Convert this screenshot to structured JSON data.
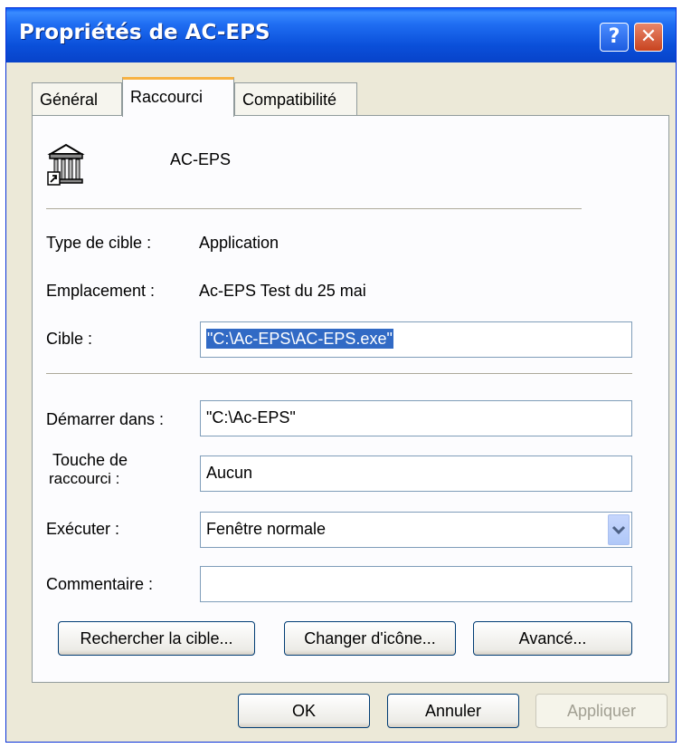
{
  "window": {
    "title": "Propriétés de AC-EPS",
    "help": "?",
    "close": "✕"
  },
  "tabs": [
    {
      "label": "Général",
      "active": false
    },
    {
      "label": "Raccourci",
      "active": true
    },
    {
      "label": "Compatibilité",
      "active": false
    }
  ],
  "shortcut": {
    "icon": "shortcut-app-icon",
    "name": "AC-EPS",
    "target_type_label": "Type de cible :",
    "target_type_value": "Application",
    "location_label": "Emplacement :",
    "location_value": "Ac-EPS Test du 25 mai",
    "target_label": "Cible :",
    "target_value": "\"C:\\Ac-EPS\\AC-EPS.exe\"",
    "start_in_label": "Démarrer dans :",
    "start_in_value": "\"C:\\Ac-EPS\"",
    "hotkey_label_1": "Touche de",
    "hotkey_label_2": "raccourci :",
    "hotkey_value": "Aucun",
    "run_label": "Exécuter :",
    "run_value": "Fenêtre normale",
    "comment_label": "Commentaire :",
    "comment_value": "",
    "find_target_button": "Rechercher la cible...",
    "change_icon_button": "Changer d'icône...",
    "advanced_button": "Avancé..."
  },
  "footer": {
    "ok": "OK",
    "cancel": "Annuler",
    "apply": "Appliquer"
  },
  "colors": {
    "titlebar": "#0a4fd9",
    "tab_highlight": "#f7b242",
    "selection": "#316ac5",
    "face": "#ece9d8"
  }
}
